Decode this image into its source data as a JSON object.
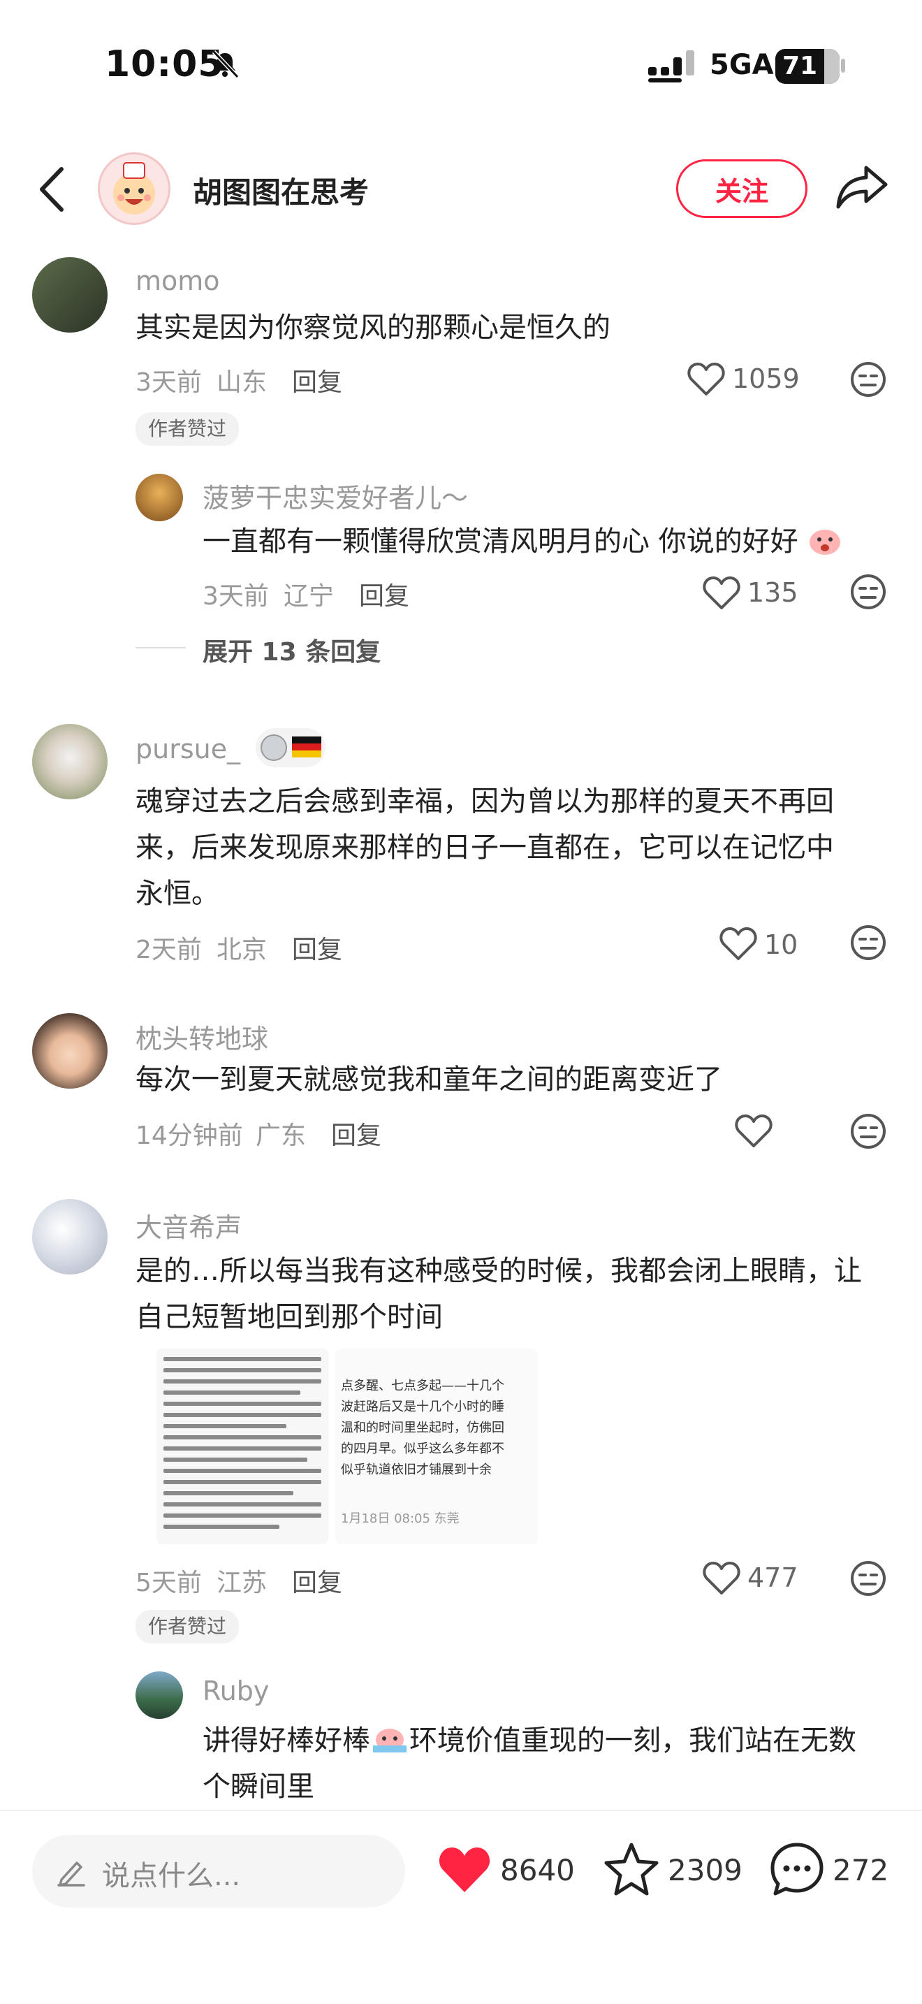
{
  "status": {
    "time": "10:05",
    "network": "5GA",
    "battery": "71"
  },
  "header": {
    "name": "胡图图在思考",
    "follow_label": "关注"
  },
  "comments": [
    {
      "user": "momo",
      "text": "其实是因为你察觉风的那颗心是恒久的",
      "time": "3天前",
      "location": "山东",
      "reply_label": "回复",
      "likes": "1059",
      "badge": "作者赞过",
      "replies": [
        {
          "user": "菠萝干忠实爱好者儿～",
          "text": "一直都有一颗懂得欣赏清风明月的心  你说的好好",
          "time": "3天前",
          "location": "辽宁",
          "reply_label": "回复",
          "likes": "135"
        }
      ],
      "expand_label": "展开 13 条回复"
    },
    {
      "user": "pursue_",
      "text_lines": [
        "魂穿过去之后会感到幸福，因为曾以为那样的夏天不再回",
        "来，后来发现原来那样的日子一直都在，它可以在记忆中",
        "永恒。"
      ],
      "time": "2天前",
      "location": "北京",
      "reply_label": "回复",
      "likes": "10"
    },
    {
      "user": "枕头转地球",
      "text": "每次一到夏天就感觉我和童年之间的距离变近了",
      "time": "14分钟前",
      "location": "广东",
      "reply_label": "回复"
    },
    {
      "user": "大音希声",
      "text_lines": [
        "是的…所以每当我有这种感受的时候，我都会闭上眼睛，让",
        "自己短暂地回到那个时间"
      ],
      "image2_lines": [
        "点多醒、七点多起——十几个",
        "波赶路后又是十几个小时的睡",
        "温和的时间里坐起时，仿佛回",
        "的四月早。似乎这么多年都不",
        "似乎轨道依旧才铺展到十余",
        "1月18日 08:05 东莞"
      ],
      "time": "5天前",
      "location": "江苏",
      "reply_label": "回复",
      "likes": "477",
      "badge": "作者赞过",
      "replies": [
        {
          "user": "Ruby",
          "text_lines": [
            "讲得好棒好棒",
            "环境价值重现的一刻，我们站在无数",
            "个瞬间里"
          ]
        }
      ]
    }
  ],
  "bottom": {
    "placeholder": "说点什么...",
    "likes": "8640",
    "stars": "2309",
    "comments": "272"
  },
  "colors": {
    "accent": "#ff2442",
    "muted": "#999999"
  }
}
